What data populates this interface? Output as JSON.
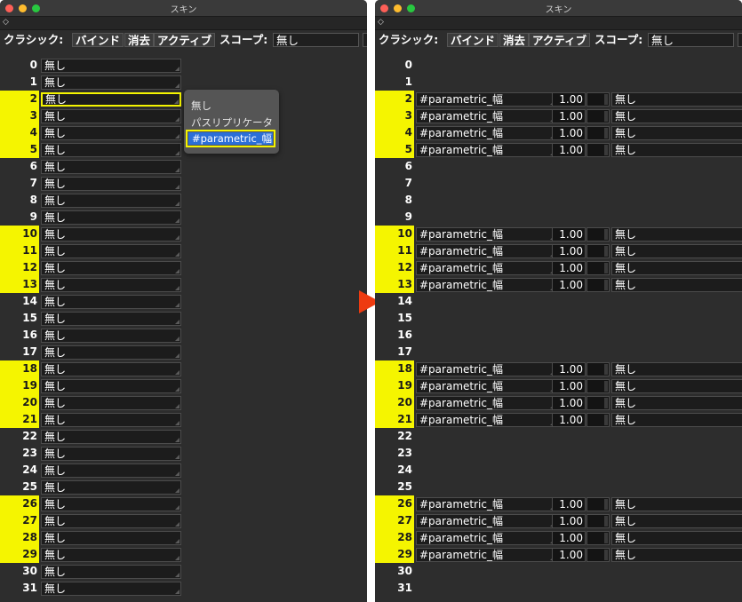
{
  "title": "スキン",
  "scope_bar": {
    "label": "クラシック:",
    "bind_button": "バインド",
    "clear_button": "消去",
    "active_button": "アクティブ",
    "scope_label": "スコープ:",
    "scope_value": "無し"
  },
  "none_label": "無し",
  "param_label": "#parametric_幅",
  "value_label": "1.00",
  "popup": {
    "items": [
      "無し",
      "パスリプリケータ",
      "#parametric_幅"
    ]
  },
  "rows": [
    {
      "index": "0",
      "highlighted": false
    },
    {
      "index": "1",
      "highlighted": false
    },
    {
      "index": "2",
      "highlighted": true
    },
    {
      "index": "3",
      "highlighted": true
    },
    {
      "index": "4",
      "highlighted": true
    },
    {
      "index": "5",
      "highlighted": true
    },
    {
      "index": "6",
      "highlighted": false
    },
    {
      "index": "7",
      "highlighted": false
    },
    {
      "index": "8",
      "highlighted": false
    },
    {
      "index": "9",
      "highlighted": false
    },
    {
      "index": "10",
      "highlighted": true
    },
    {
      "index": "11",
      "highlighted": true
    },
    {
      "index": "12",
      "highlighted": true
    },
    {
      "index": "13",
      "highlighted": true
    },
    {
      "index": "14",
      "highlighted": false
    },
    {
      "index": "15",
      "highlighted": false
    },
    {
      "index": "16",
      "highlighted": false
    },
    {
      "index": "17",
      "highlighted": false
    },
    {
      "index": "18",
      "highlighted": true
    },
    {
      "index": "19",
      "highlighted": true
    },
    {
      "index": "20",
      "highlighted": true
    },
    {
      "index": "21",
      "highlighted": true
    },
    {
      "index": "22",
      "highlighted": false
    },
    {
      "index": "23",
      "highlighted": false
    },
    {
      "index": "24",
      "highlighted": false
    },
    {
      "index": "25",
      "highlighted": false
    },
    {
      "index": "26",
      "highlighted": true
    },
    {
      "index": "27",
      "highlighted": true
    },
    {
      "index": "28",
      "highlighted": true
    },
    {
      "index": "29",
      "highlighted": true
    },
    {
      "index": "30",
      "highlighted": false
    },
    {
      "index": "31",
      "highlighted": false
    }
  ],
  "colors": {
    "highlight": "#f5f500",
    "selection": "#2b6fd8",
    "arrow": "#ee3b10"
  }
}
